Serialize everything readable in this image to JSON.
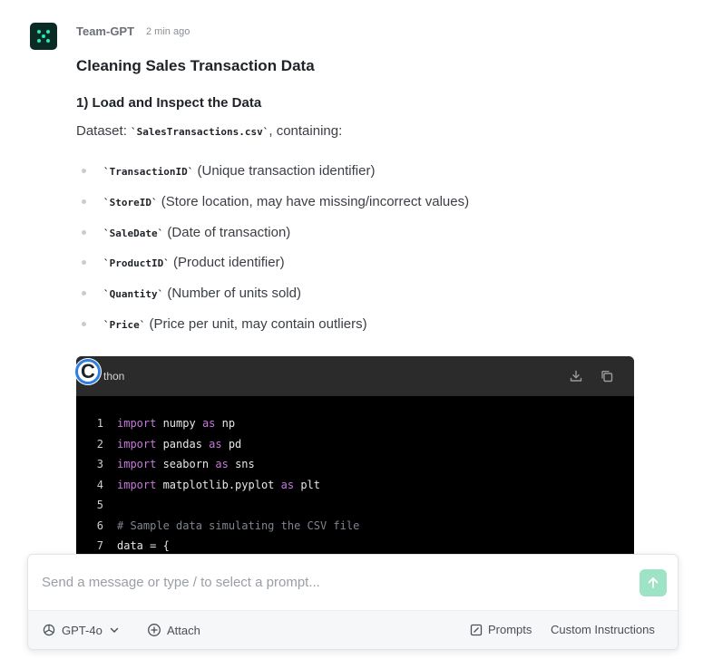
{
  "message": {
    "sender": "Team-GPT",
    "time": "2 min ago",
    "title": "Cleaning Sales Transaction Data",
    "section_title": "1) Load and Inspect the Data",
    "dataset_prefix": "Dataset: ",
    "dataset_file": "`SalesTransactions.csv`",
    "dataset_suffix": ", containing:",
    "fields": [
      {
        "code": "`TransactionID`",
        "desc": " (Unique transaction identifier)"
      },
      {
        "code": "`StoreID`",
        "desc": " (Store location, may have missing/incorrect values)"
      },
      {
        "code": "`SaleDate`",
        "desc": " (Date of transaction)"
      },
      {
        "code": "`ProductID`",
        "desc": " (Product identifier)"
      },
      {
        "code": "`Quantity`",
        "desc": " (Number of units sold)"
      },
      {
        "code": "`Price`",
        "desc": " (Price per unit, may contain outliers)"
      }
    ]
  },
  "code_block": {
    "language": "thon",
    "badge_letter": "C",
    "lines": [
      {
        "num": "1",
        "kw": "import",
        "a": " numpy ",
        "kw2": "as",
        "b": " np"
      },
      {
        "num": "2",
        "kw": "import",
        "a": " pandas ",
        "kw2": "as",
        "b": " pd"
      },
      {
        "num": "3",
        "kw": "import",
        "a": " seaborn ",
        "kw2": "as",
        "b": " sns"
      },
      {
        "num": "4",
        "kw": "import",
        "a": " matplotlib.pyplot ",
        "kw2": "as",
        "b": " plt"
      },
      {
        "num": "5",
        "kw": "",
        "a": "",
        "kw2": "",
        "b": ""
      },
      {
        "num": "6",
        "comment": "# Sample data simulating the CSV file"
      },
      {
        "num": "7",
        "kw": "",
        "a": "data = {",
        "kw2": "",
        "b": ""
      }
    ],
    "colors": {
      "keyword": "#c678dd",
      "text": "#e6e6e6",
      "comment": "#7f848e"
    }
  },
  "composer": {
    "placeholder": "Send a message or type / to select a prompt...",
    "model": "GPT-4o",
    "attach": "Attach",
    "prompts": "Prompts",
    "custom_instructions": "Custom Instructions"
  },
  "icons": {
    "avatar": "team-gpt-logo-icon",
    "download": "download-icon",
    "copy": "copy-icon",
    "send": "arrow-up-icon",
    "model": "openai-icon",
    "attach": "plus-circle-icon",
    "prompts": "edit-square-icon"
  },
  "theme": {
    "accent": "#9ee3c5",
    "badge_border": "#2f7fe0"
  }
}
